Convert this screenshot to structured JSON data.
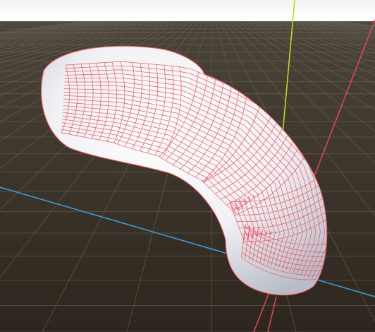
{
  "viewport": {
    "type": "3d-viewport",
    "object": "curved-tube-mesh",
    "shading": "smooth",
    "overlay": "wireframe"
  },
  "colors": {
    "sky_top": "#f3f3f3",
    "sky_horizon": "#ffffff",
    "ground_near": "#2c261e",
    "ground_far": "#4b4438",
    "grid_line": "#6c665a",
    "x_axis": "#e0435a",
    "y_axis": "#3a9ad8",
    "z_axis": "#b6dc1c",
    "mesh_fill": "#f0f1f4",
    "mesh_shadow": "#b8bcc8",
    "wireframe": "#f0555f"
  }
}
